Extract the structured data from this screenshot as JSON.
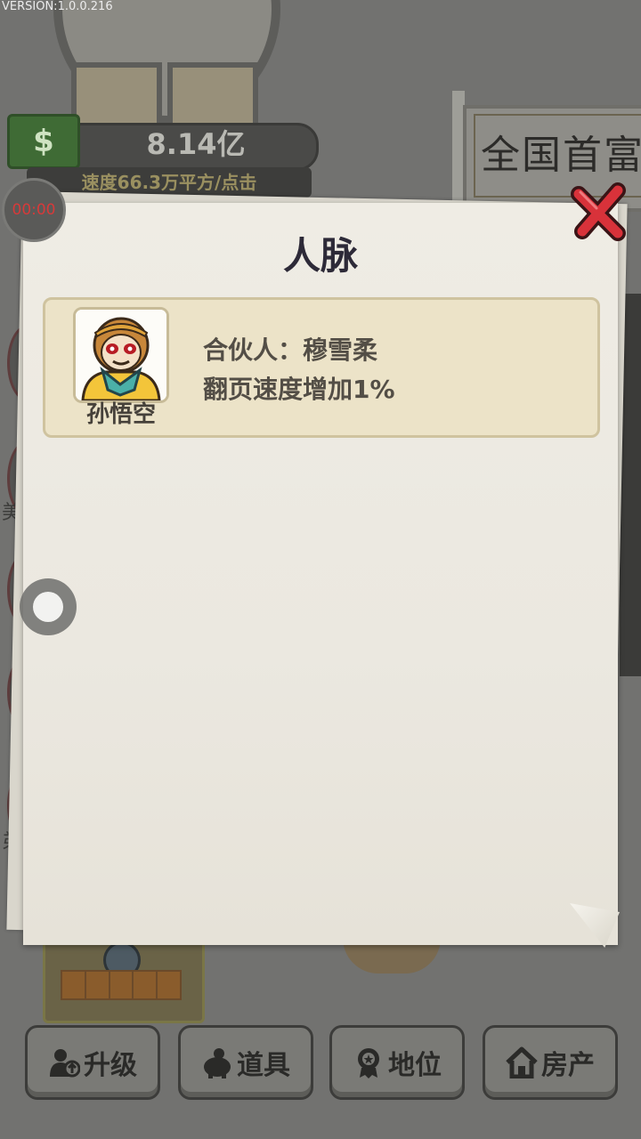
{
  "version": "VERSION:1.0.0.216",
  "hud": {
    "money": "8.14亿",
    "speed": "速度66.3万平方/点击",
    "timer": "00:00",
    "banner": "全国首富",
    "money_icon_symbol": "$"
  },
  "side_labels": [
    "美",
    "弟"
  ],
  "modal": {
    "title": "人脉",
    "card": {
      "avatar_name": "孙悟空",
      "partner": "合伙人：穆雪柔",
      "bonus": "翻页速度增加1%"
    }
  },
  "bottom_nav": {
    "upgrade": "升级",
    "items": "道具",
    "status": "地位",
    "property": "房产"
  },
  "colors": {
    "close_red": "#d8323a",
    "title": "#2d2a38",
    "card_bg": "#ece3c8"
  }
}
